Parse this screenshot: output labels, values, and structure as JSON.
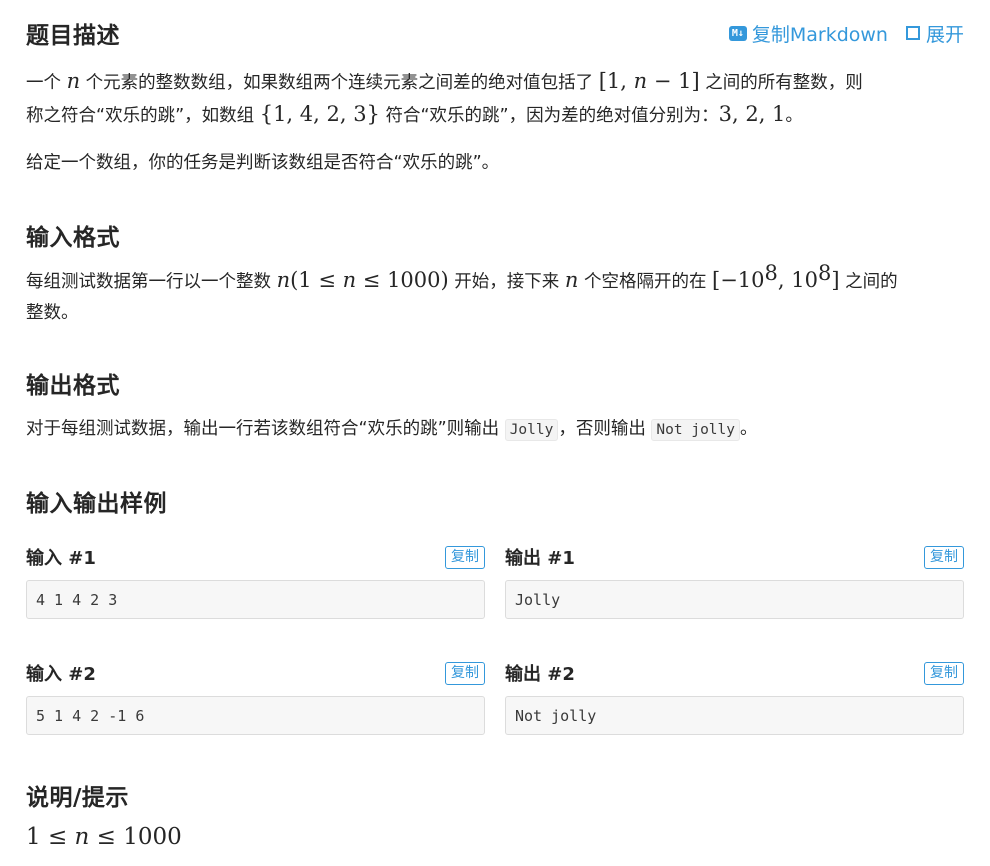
{
  "header": {
    "title": "题目描述",
    "copy_markdown_badge": "M↓",
    "copy_markdown_label": "复制Markdown",
    "expand_label": "展开"
  },
  "description": {
    "p1_a": "一个 ",
    "p1_n": "n",
    "p1_b": " 个元素的整数数组，如果数组两个连续元素之间差的绝对值包括了 ",
    "p1_range_open": "[1, ",
    "p1_range_n": "n",
    "p1_range_close": " − 1]",
    "p1_c": " 之间的所有整数，则",
    "p1_d": "称之符合“欢乐的跳”，如数组 ",
    "p1_set": "{1, 4, 2, 3}",
    "p1_e": " 符合“欢乐的跳”，因为差的绝对值分别为：",
    "p1_diffs": "3, 2, 1",
    "p1_f": "。",
    "p2": "给定一个数组，你的任务是判断该数组是否符合“欢乐的跳”。"
  },
  "input_format": {
    "title": "输入格式",
    "a": "每组测试数据第一行以一个整数 ",
    "n": "n",
    "cond_open": "(1 ≤ ",
    "cond_n": "n",
    "cond_close": " ≤ 1000)",
    "b": " 开始，接下来 ",
    "n2": "n",
    "c": " 个空格隔开的在 ",
    "range_a": "[−10",
    "exp1": "8",
    "range_b": ", 10",
    "exp2": "8",
    "range_c": "]",
    "d": " 之间的",
    "e": "整数。"
  },
  "output_format": {
    "title": "输出格式",
    "a": "对于每组测试数据，输出一行若该数组符合“欢乐的跳”则输出 ",
    "code1": "Jolly",
    "b": "，否则输出 ",
    "code2": "Not jolly",
    "c": "。"
  },
  "samples": {
    "title": "输入输出样例",
    "copy_label": "复制",
    "items": [
      {
        "in_label": "输入 #1",
        "in": "4 1 4 2 3",
        "out_label": "输出 #1",
        "out": "Jolly"
      },
      {
        "in_label": "输入 #2",
        "in": "5 1 4 2 -1 6",
        "out_label": "输出 #2",
        "out": "Not jolly"
      }
    ]
  },
  "hint": {
    "title": "说明/提示",
    "a": "1 ≤ ",
    "n": "n",
    "b": " ≤ 1000"
  }
}
